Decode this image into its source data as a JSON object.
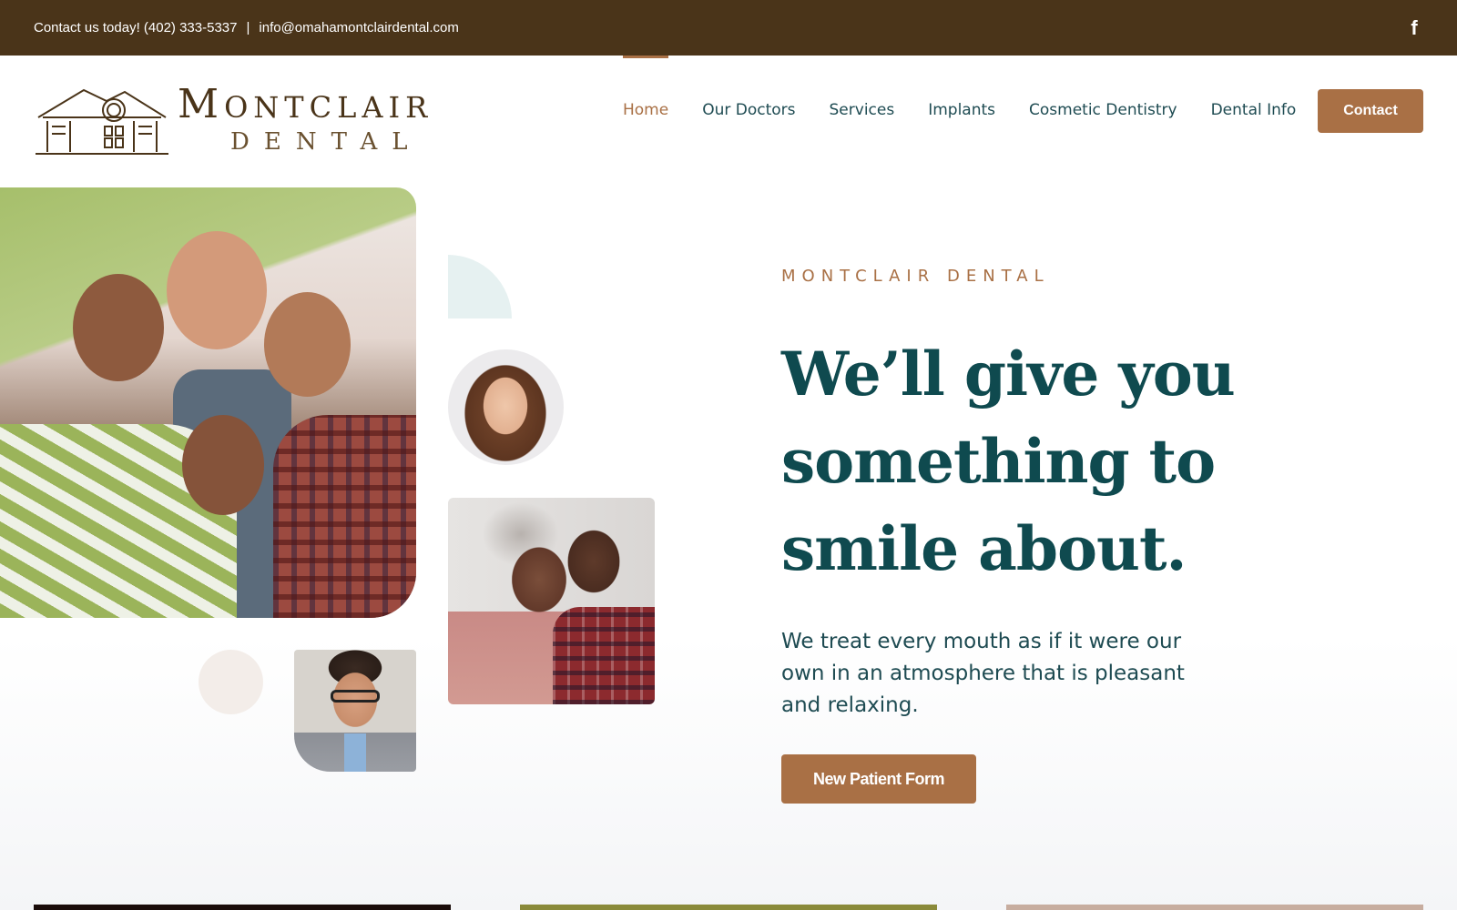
{
  "topbar": {
    "contact_text": "Contact us today! (402) 333-5337",
    "separator": "|",
    "email": "info@omahamontclairdental.com",
    "facebook_icon": "facebook-icon",
    "background": "#4a3419"
  },
  "header": {
    "logo": {
      "main_initial": "M",
      "main_rest": "ONTCLAIR",
      "sub": "DENTAL"
    },
    "nav": [
      {
        "label": "Home",
        "active": true
      },
      {
        "label": "Our Doctors"
      },
      {
        "label": "Services"
      },
      {
        "label": "Implants"
      },
      {
        "label": "Cosmetic Dentistry"
      },
      {
        "label": "Dental Info"
      }
    ],
    "contact_button": "Contact"
  },
  "hero": {
    "eyebrow": "MONTCLAIR DENTAL",
    "title": "We’ll give you something to smile about.",
    "subtitle": "We treat every mouth as if it were our own in an atmosphere that is pleasant and relaxing.",
    "cta": "New Patient Form"
  },
  "colors": {
    "accent": "#a97045",
    "heading": "#0f4a4f",
    "text": "#1e4b52"
  }
}
